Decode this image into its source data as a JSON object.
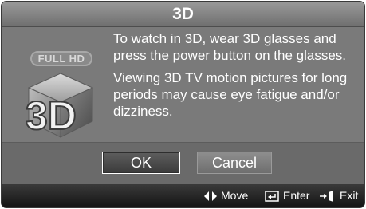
{
  "dialog": {
    "title": "3D",
    "badge": "FULL HD",
    "logo_text": "3D",
    "messages": [
      "To watch in 3D, wear 3D glasses and press the power button on the glasses.",
      "Viewing 3D TV motion pictures for long periods may cause eye fatigue and/or dizziness."
    ],
    "buttons": {
      "ok": "OK",
      "cancel": "Cancel"
    },
    "focused_button": "OK"
  },
  "footer": {
    "move": {
      "icon": "left-right-arrows-icon",
      "label": "Move"
    },
    "enter": {
      "icon": "enter-icon",
      "label": "Enter"
    },
    "exit": {
      "icon": "exit-icon",
      "label": "Exit"
    }
  },
  "colors": {
    "panel": "#7a7a7a",
    "footer": "#141414",
    "text": "#ffffff"
  }
}
